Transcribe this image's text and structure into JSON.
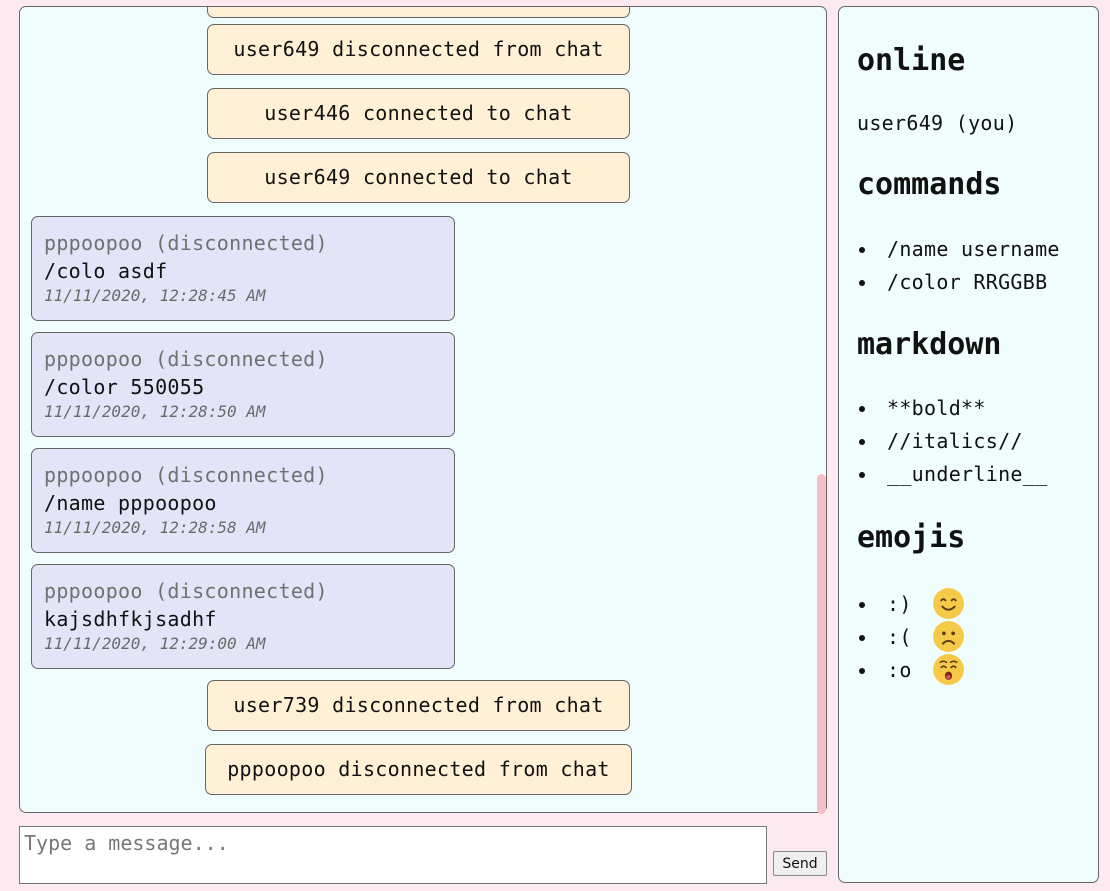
{
  "chat": {
    "system_messages": [
      {
        "text": ""
      },
      {
        "text": "user649 disconnected from chat"
      },
      {
        "text": "user446 connected to chat"
      },
      {
        "text": "user649 connected to chat"
      },
      {
        "text": "user739 disconnected from chat"
      },
      {
        "text": "pppoopoo disconnected from chat"
      }
    ],
    "messages": [
      {
        "author": "pppoopoo (disconnected)",
        "text": "/colo asdf",
        "time": "11/11/2020, 12:28:45 AM"
      },
      {
        "author": "pppoopoo (disconnected)",
        "text": "/color 550055",
        "time": "11/11/2020, 12:28:50 AM"
      },
      {
        "author": "pppoopoo (disconnected)",
        "text": "/name pppoopoo",
        "time": "11/11/2020, 12:28:58 AM"
      },
      {
        "author": "pppoopoo (disconnected)",
        "text": "kajsdhfkjsadhf",
        "time": "11/11/2020, 12:29:00 AM"
      }
    ]
  },
  "composer": {
    "placeholder": "Type a message...",
    "send_label": "Send"
  },
  "sidebar": {
    "online": {
      "heading": "online",
      "users": [
        "user649 (you)"
      ]
    },
    "commands": {
      "heading": "commands",
      "items": [
        "/name username",
        "/color RRGGBB"
      ]
    },
    "markdown": {
      "heading": "markdown",
      "items": [
        "**bold**",
        "//italics//",
        "__underline__"
      ]
    },
    "emojis": {
      "heading": "emojis",
      "items": [
        {
          "code": ":)",
          "icon": "smiling-face-icon"
        },
        {
          "code": ":(",
          "icon": "frowning-face-icon"
        },
        {
          "code": ":o",
          "icon": "surprised-face-icon"
        }
      ]
    }
  }
}
